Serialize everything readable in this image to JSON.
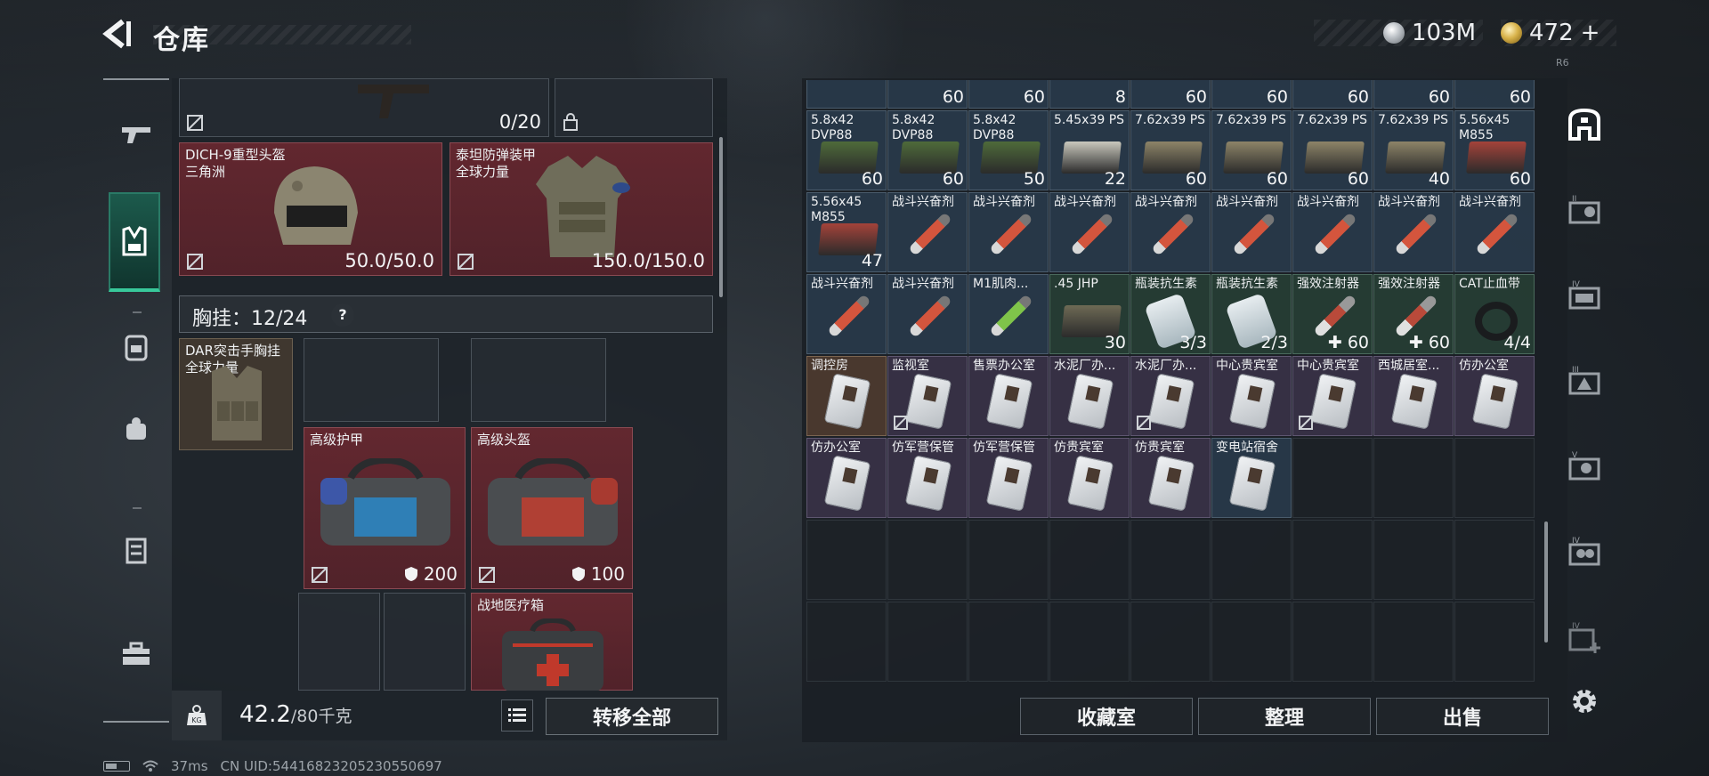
{
  "header": {
    "title": "仓库",
    "currency": [
      {
        "value": "103M",
        "icon": "silver-coin-icon"
      },
      {
        "value": "472",
        "icon": "gold-coin-icon",
        "suffix": "+"
      }
    ],
    "right_label": "R6"
  },
  "left_nav": {
    "items": [
      "gun-icon",
      "vest-icon",
      "backpack-icon",
      "pouch-icon",
      "case-icon",
      "toolbox-icon"
    ],
    "active": "vest-icon"
  },
  "loadout": {
    "top_slot": {
      "value": "0/20"
    },
    "helmet": {
      "name_line1": "DICH-9重型头盔",
      "name_line2": "三角洲",
      "value": "50.0/50.0"
    },
    "armor": {
      "name_line1": "泰坦防弹装甲",
      "name_line2": "全球力量",
      "value": "150.0/150.0"
    },
    "chest_rig": {
      "label": "胸挂：12/24",
      "help": "?"
    },
    "rig_item": {
      "name_line1": "DAR突击手胸挂",
      "name_line2": "全球力量"
    },
    "bag_armor": {
      "name": "高级护甲",
      "value": "200"
    },
    "bag_helmet": {
      "name": "高级头盔",
      "value": "100"
    },
    "medkit": {
      "name": "战地医疗箱"
    }
  },
  "left_bottom": {
    "weight": "42.2",
    "weight_max": "/80千克",
    "transfer_label": "转移全部"
  },
  "stash": {
    "row0_counts": [
      "60",
      "60",
      "8",
      "60",
      "60",
      "60",
      "60",
      "60"
    ],
    "row1": [
      {
        "name": "5.8x42 DVP88",
        "count": "60",
        "color": "blue",
        "box": "#4f6b3a"
      },
      {
        "name": "5.8x42 DVP88",
        "count": "60",
        "color": "blue",
        "box": "#4f6b3a"
      },
      {
        "name": "5.8x42 DVP88",
        "count": "50",
        "color": "blue",
        "box": "#4f6b3a"
      },
      {
        "name": "5.45x39 PS",
        "count": "22",
        "color": "blue",
        "box": "#c9c8bd"
      },
      {
        "name": "7.62x39 PS",
        "count": "60",
        "color": "blue",
        "box": "#8d8468"
      },
      {
        "name": "7.62x39 PS",
        "count": "60",
        "color": "blue",
        "box": "#8d8468"
      },
      {
        "name": "7.62x39 PS",
        "count": "60",
        "color": "blue",
        "box": "#8d8468"
      },
      {
        "name": "7.62x39 PS",
        "count": "40",
        "color": "blue",
        "box": "#8d8468"
      },
      {
        "name": "5.56x45 M855",
        "count": "60",
        "color": "blue",
        "box": "#a4433a"
      }
    ],
    "row2": [
      {
        "name": "5.56x45 M855",
        "count": "47",
        "color": "blue",
        "kind": "ammo",
        "box": "#a4433a"
      },
      {
        "name": "战斗兴奋剂",
        "count": "",
        "color": "blue",
        "kind": "syringe"
      },
      {
        "name": "战斗兴奋剂",
        "count": "",
        "color": "blue",
        "kind": "syringe"
      },
      {
        "name": "战斗兴奋剂",
        "count": "",
        "color": "blue",
        "kind": "syringe"
      },
      {
        "name": "战斗兴奋剂",
        "count": "",
        "color": "blue",
        "kind": "syringe"
      },
      {
        "name": "战斗兴奋剂",
        "count": "",
        "color": "blue",
        "kind": "syringe"
      },
      {
        "name": "战斗兴奋剂",
        "count": "",
        "color": "blue",
        "kind": "syringe"
      },
      {
        "name": "战斗兴奋剂",
        "count": "",
        "color": "blue",
        "kind": "syringe"
      },
      {
        "name": "战斗兴奋剂",
        "count": "",
        "color": "blue",
        "kind": "syringe"
      }
    ],
    "row3": [
      {
        "name": "战斗兴奋剂",
        "count": "",
        "color": "blue",
        "kind": "syringe"
      },
      {
        "name": "战斗兴奋剂",
        "count": "",
        "color": "blue",
        "kind": "syringe"
      },
      {
        "name": "M1肌肉...",
        "count": "",
        "color": "blue",
        "kind": "syringe-green"
      },
      {
        "name": ".45 JHP",
        "count": "30",
        "color": "green",
        "kind": "ammo",
        "box": "#6e6a55"
      },
      {
        "name": "瓶装抗生素",
        "count": "3/3",
        "color": "green",
        "kind": "bottle"
      },
      {
        "name": "瓶装抗生素",
        "count": "2/3",
        "color": "green",
        "kind": "bottle"
      },
      {
        "name": "强效注射器",
        "count": "60",
        "color": "green",
        "kind": "syringe-red",
        "plus": true
      },
      {
        "name": "强效注射器",
        "count": "60",
        "color": "green",
        "kind": "syringe-red",
        "plus": true
      },
      {
        "name": "CAT止血带",
        "count": "4/4",
        "color": "green",
        "kind": "bandage"
      }
    ],
    "row4": [
      {
        "name": "调控房",
        "color": "brown",
        "nodrop": false
      },
      {
        "name": "监视室",
        "color": "purple",
        "nodrop": true
      },
      {
        "name": "售票办公室",
        "color": "purple",
        "nodrop": false
      },
      {
        "name": "水泥厂办...",
        "color": "purple",
        "nodrop": false
      },
      {
        "name": "水泥厂办...",
        "color": "purple",
        "nodrop": true
      },
      {
        "name": "中心贵宾室",
        "color": "purple",
        "nodrop": false
      },
      {
        "name": "中心贵宾室",
        "color": "purple",
        "nodrop": true
      },
      {
        "name": "西城居室...",
        "color": "purple",
        "nodrop": false
      },
      {
        "name": "仿办公室",
        "color": "purple",
        "nodrop": false
      }
    ],
    "row5": [
      {
        "name": "仿办公室",
        "color": "purple"
      },
      {
        "name": "仿军营保管",
        "color": "purple"
      },
      {
        "name": "仿军营保管",
        "color": "purple"
      },
      {
        "name": "仿贵宾室",
        "color": "purple"
      },
      {
        "name": "仿贵宾室",
        "color": "purple"
      },
      {
        "name": "变电站宿舍",
        "color": "blue"
      }
    ]
  },
  "stash_buttons": {
    "collection": "收藏室",
    "organize": "整理",
    "sell": "出售"
  },
  "status": {
    "ping": "37ms",
    "uid": "CN UID:544168232052305506​97"
  }
}
